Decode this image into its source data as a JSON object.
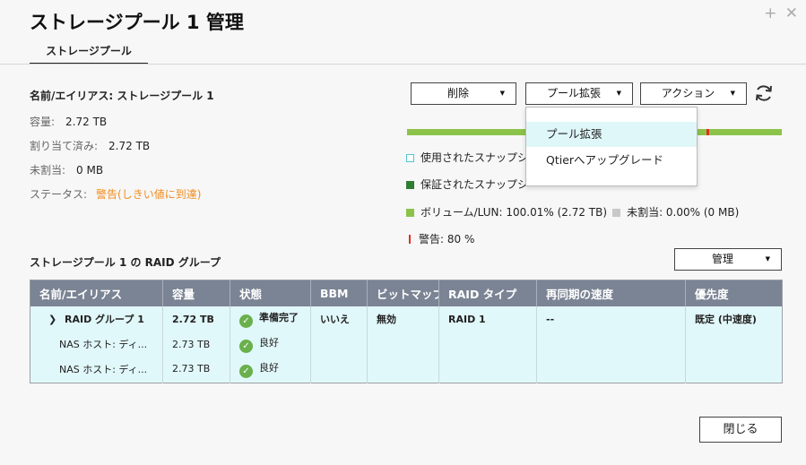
{
  "window": {
    "title": "ストレージプール 1 管理",
    "add_glyph": "+",
    "close_glyph": "✕"
  },
  "tabs": [
    {
      "label": "ストレージプール"
    }
  ],
  "pool_info": {
    "name_label": "名前/エイリアス: ストレージプール 1",
    "capacity_label": "容量:",
    "capacity_value": "2.72 TB",
    "allocated_label": "割り当て済み:",
    "allocated_value": "2.72 TB",
    "unallocated_label": "未割当:",
    "unallocated_value": "0 MB",
    "status_label": "ステータス:",
    "status_value": "警告(しきい値に到達)"
  },
  "toolbar": {
    "delete_label": "削除",
    "expand_label": "プール拡張",
    "action_label": "アクション",
    "refresh_icon": "refresh-icon"
  },
  "dropdown": {
    "items": [
      {
        "label": "プール拡張"
      },
      {
        "label": "Qtierへアップグレード"
      }
    ]
  },
  "usage": {
    "volume_fraction": 1.0001,
    "warning_threshold_percent": 80,
    "colors": {
      "volume": "#8bc34a",
      "guaranteed": "#2f7d32",
      "used_snapshot": "#4fc8d3",
      "unallocated": "#c8c8c8",
      "warning": "#e0301e"
    },
    "legend": {
      "used_snapshot": "使用されたスナップシ",
      "guaranteed_snapshot": "保証されたスナップシ",
      "volume_lun": "ボリューム/LUN: 100.01% (2.72 TB)",
      "unallocated": "未割当: 0.00% (0 MB)",
      "warning": "警告: 80 %"
    }
  },
  "raid_section": {
    "title": "ストレージプール 1 の RAID グループ",
    "manage_label": "管理",
    "columns": [
      "名前/エイリアス",
      "容量",
      "状態",
      "BBM",
      "ビットマップ",
      "RAID タイプ",
      "再同期の速度",
      "優先度"
    ],
    "group": {
      "name": "RAID グループ 1",
      "capacity": "2.72 TB",
      "status": "準備完了",
      "bbm": "いいえ",
      "bitmap": "無効",
      "raid_type": "RAID 1",
      "resync_speed": "--",
      "priority": "既定 (中速度)"
    },
    "disks": [
      {
        "name": "NAS ホスト: ディ...",
        "capacity": "2.73 TB",
        "status": "良好"
      },
      {
        "name": "NAS ホスト: ディ...",
        "capacity": "2.73 TB",
        "status": "良好"
      }
    ]
  },
  "footer": {
    "close_label": "閉じる"
  }
}
